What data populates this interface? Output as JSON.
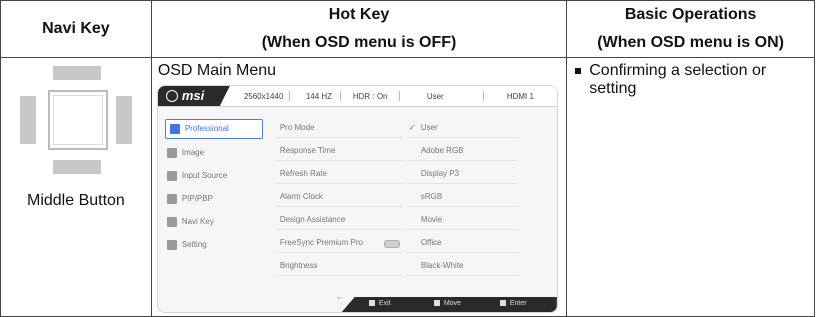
{
  "headers": {
    "navi": "Navi Key",
    "hot_line1": "Hot Key",
    "hot_line2": "(When OSD menu is OFF)",
    "ops_line1": "Basic Operations",
    "ops_line2": "(When OSD menu is ON)"
  },
  "navi": {
    "label": "Middle Button"
  },
  "hotkey": {
    "title": "OSD Main Menu",
    "osd": {
      "logo": "msi",
      "status": [
        "2560x1440",
        "144 HZ",
        "HDR : On",
        "User",
        "HDMI 1"
      ],
      "left_menu": [
        {
          "label": "Professional",
          "icon": "professional-icon"
        },
        {
          "label": "Image",
          "icon": "image-icon"
        },
        {
          "label": "Input Source",
          "icon": "input-source-icon"
        },
        {
          "label": "PIP/PBP",
          "icon": "pip-pbp-icon"
        },
        {
          "label": "Navi Key",
          "icon": "navi-key-icon"
        },
        {
          "label": "Setting",
          "icon": "setting-icon"
        }
      ],
      "middle_menu": [
        "Pro Mode",
        "Response Time",
        "Refresh Rate",
        "Alarm Clock",
        "Design Assistance",
        "FreeSync Premium Pro",
        "Brightness"
      ],
      "right_menu": [
        "User",
        "Adobe RGB",
        "Display P3",
        "sRGB",
        "Movie",
        "Office",
        "Black-White"
      ],
      "bottom": [
        "Exit",
        "Move",
        "Enter"
      ]
    }
  },
  "operations": {
    "text": "Confirming a selection or setting"
  }
}
